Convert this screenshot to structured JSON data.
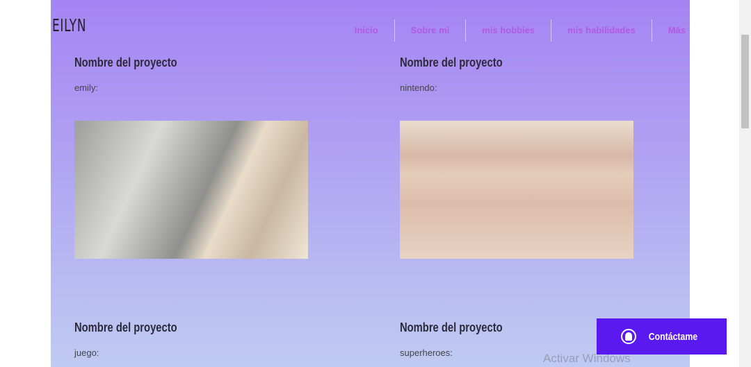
{
  "header": {
    "logo": "EILYN",
    "nav": [
      "Inicio",
      "Sobre mi",
      "mis hobbies",
      "mis habilidades",
      "Más"
    ]
  },
  "projects": [
    {
      "title": "Nombre del proyecto",
      "desc": "emily:"
    },
    {
      "title": "Nombre del proyecto",
      "desc": "nintendo:"
    },
    {
      "title": "Nombre del proyecto",
      "desc": "juego:"
    },
    {
      "title": "Nombre del proyecto",
      "desc": "superheroes:"
    }
  ],
  "contact": {
    "label": "Contáctame",
    "icon": "chat-icon"
  },
  "watermark": "Activar Windows",
  "colors": {
    "bg_top": "#a584f3",
    "bg_bottom": "#bfcbf2",
    "nav": "#b25be0",
    "button": "#5a19ee"
  }
}
